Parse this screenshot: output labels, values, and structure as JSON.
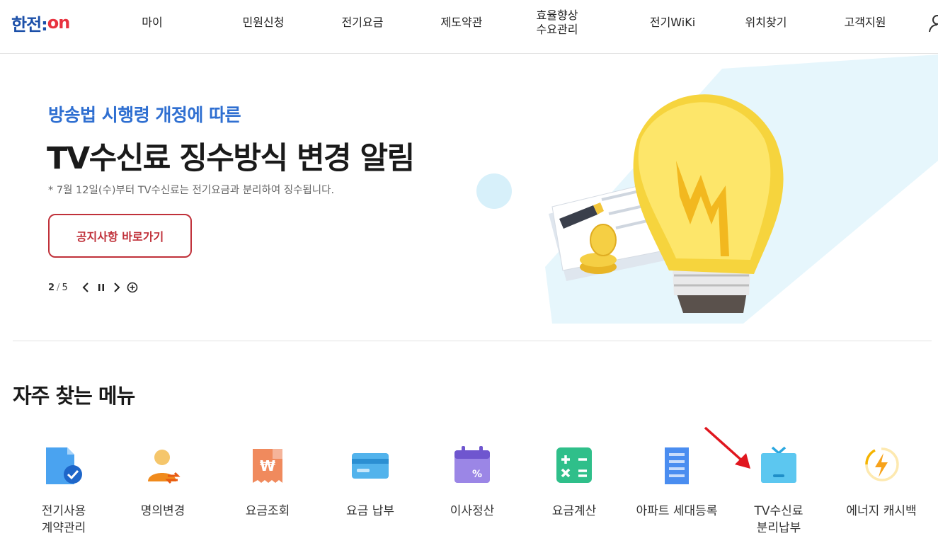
{
  "header": {
    "logo_text_1": "한전:",
    "logo_text_2": "on",
    "nav": [
      {
        "label": "마이"
      },
      {
        "label": "민원신청"
      },
      {
        "label": "전기요금"
      },
      {
        "label": "제도약관"
      },
      {
        "label": "효율향상\n수요관리"
      },
      {
        "label": "전기WiKi"
      },
      {
        "label": "위치찾기"
      },
      {
        "label": "고객지원"
      }
    ]
  },
  "hero": {
    "subtitle": "방송법 시행령 개정에 따른",
    "title": "TV수신료 징수방식 변경 알림",
    "note": "* 7월 12일(수)부터 TV수신료는 전기요금과 분리하여 징수됩니다.",
    "button_label": "공지사항 바로가기",
    "slide_current": "2",
    "slide_sep": "/",
    "slide_total": "5"
  },
  "frequent": {
    "title": "자주 찾는 메뉴",
    "items": [
      {
        "label": "전기사용\n계약관리",
        "icon": "contract-doc-icon"
      },
      {
        "label": "명의변경",
        "icon": "person-change-icon"
      },
      {
        "label": "요금조회",
        "icon": "bill-won-icon"
      },
      {
        "label": "요금 납부",
        "icon": "card-icon"
      },
      {
        "label": "이사정산",
        "icon": "calendar-percent-icon"
      },
      {
        "label": "요금계산",
        "icon": "calculator-icon"
      },
      {
        "label": "아파트 세대등록",
        "icon": "apartment-icon"
      },
      {
        "label": "TV수신료\n분리납부",
        "icon": "tv-icon"
      },
      {
        "label": "에너지 캐시백",
        "icon": "energy-bolt-icon"
      }
    ]
  },
  "colors": {
    "brand_blue": "#1b4fa8",
    "brand_red": "#e8323f",
    "accent_blue": "#2f6fd1",
    "button_red": "#c0313a",
    "arrow_red": "#e0161e"
  }
}
